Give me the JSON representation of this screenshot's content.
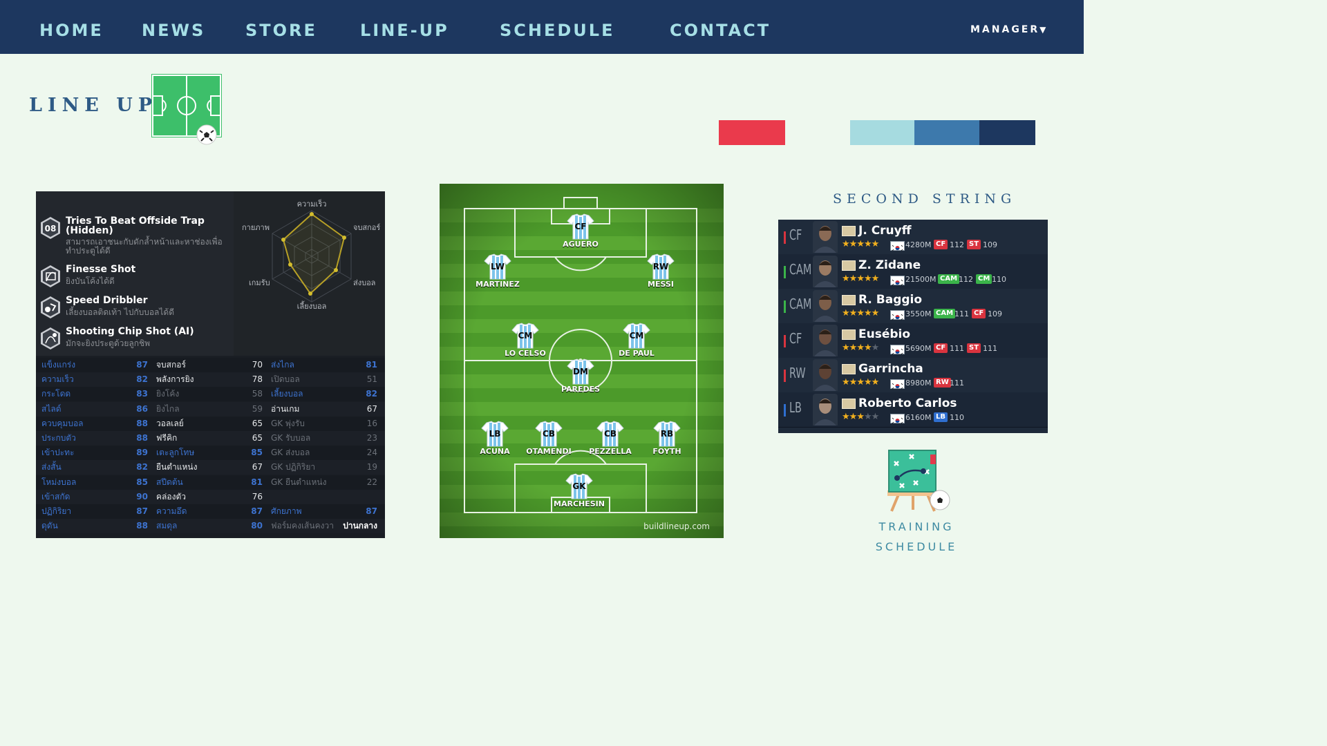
{
  "nav": {
    "items": [
      "HOME",
      "NEWS",
      "STORE",
      "LINE-UP",
      "SCHEDULE",
      "CONTACT"
    ],
    "manager_label": "MANAGER",
    "manager_caret": "▼"
  },
  "page": {
    "title": "LINE UP"
  },
  "palette": [
    "#ea3a4c",
    "#a6dbe0",
    "#3d79ac",
    "#1d375f"
  ],
  "skills": [
    {
      "badge": "08",
      "name": "Tries To Beat Offside Trap (Hidden)",
      "desc": "สามารถเอาชนะกับดักล้ำหน้าและหาช่องเพื่อทำประตูได้ดี"
    },
    {
      "badge": "finesse",
      "name": "Finesse Shot",
      "desc": "ยิงบันโค้งได้ดี"
    },
    {
      "badge": "dribble",
      "name": "Speed Dribbler",
      "desc": "เลี้ยงบอลติดเท้า ไปกับบอลได้ดี"
    },
    {
      "badge": "chip",
      "name": "Shooting Chip Shot (AI)",
      "desc": "มักจะยิงประตูด้วยลูกชิพ"
    }
  ],
  "radar": {
    "labels": [
      "ความเร็ว",
      "จบสกอร์",
      "ส่งบอล",
      "เลี้ยงบอล",
      "เกมรับ",
      "กายภาพ"
    ]
  },
  "stats": [
    [
      [
        "แข็งแกร่ง",
        "87"
      ],
      [
        "จบสกอร์",
        "70"
      ],
      [
        "ส่งไกล",
        "81"
      ]
    ],
    [
      [
        "ความเร็ว",
        "82"
      ],
      [
        "พลังการยิง",
        "78"
      ],
      [
        "เปิดบอล",
        "51"
      ]
    ],
    [
      [
        "กระโดด",
        "83"
      ],
      [
        "ยิงโค้ง",
        "58"
      ],
      [
        "เลี้ยงบอล",
        "82"
      ]
    ],
    [
      [
        "สไลด์",
        "86"
      ],
      [
        "ยิงไกล",
        "59"
      ],
      [
        "อ่านเกม",
        "67"
      ]
    ],
    [
      [
        "ควบคุมบอล",
        "88"
      ],
      [
        "วอลเลย์",
        "65"
      ],
      [
        "GK พุ่งรับ",
        "16"
      ]
    ],
    [
      [
        "ประกบตัว",
        "88"
      ],
      [
        "ฟรีคิก",
        "65"
      ],
      [
        "GK รับบอล",
        "23"
      ]
    ],
    [
      [
        "เข้าปะทะ",
        "89"
      ],
      [
        "เตะลูกโทษ",
        "85"
      ],
      [
        "GK ส่งบอล",
        "24"
      ]
    ],
    [
      [
        "ส่งสั้น",
        "82"
      ],
      [
        "ยืนตำแหน่ง",
        "67"
      ],
      [
        "GK ปฏิกิริยา",
        "19"
      ]
    ],
    [
      [
        "โหม่งบอล",
        "85"
      ],
      [
        "สปีดต้น",
        "81"
      ],
      [
        "GK ยืนตำแหน่ง",
        "22"
      ]
    ],
    [
      [
        "เข้าสกัด",
        "90"
      ],
      [
        "คล่องตัว",
        "76"
      ],
      [
        "",
        ""
      ]
    ],
    [
      [
        "ปฏิกิริยา",
        "87"
      ],
      [
        "ความอึด",
        "87"
      ],
      [
        "ศักยภาพ",
        "87"
      ]
    ],
    [
      [
        "ดุดัน",
        "88"
      ],
      [
        "สมดุล",
        "80"
      ],
      [
        "ฟอร์มคงเส้นคงวา",
        "ปานกลาง"
      ]
    ]
  ],
  "lineup": {
    "players": [
      {
        "pos": "CF",
        "name": "AGUERO"
      },
      {
        "pos": "LW",
        "name": "MARTINEZ"
      },
      {
        "pos": "RW",
        "name": "MESSI"
      },
      {
        "pos": "CM",
        "name": "LO CELSO"
      },
      {
        "pos": "CM",
        "name": "DE PAUL"
      },
      {
        "pos": "DM",
        "name": "PAREDES"
      },
      {
        "pos": "LB",
        "name": "ACUNA"
      },
      {
        "pos": "CB",
        "name": "OTAMENDI"
      },
      {
        "pos": "CB",
        "name": "PEZZELLA"
      },
      {
        "pos": "RB",
        "name": "FOYTH"
      },
      {
        "pos": "GK",
        "name": "MARCHESIN"
      }
    ],
    "watermark": "buildlineup.com"
  },
  "second_string": {
    "title": "SECOND STRING",
    "players": [
      {
        "pos": "CF",
        "pos_color": "#d9343f",
        "name": "J. Cruyff",
        "stars": 5,
        "price": "4280M",
        "tags": [
          {
            "t": "CF",
            "c": "#d9343f",
            "n": "112"
          },
          {
            "t": "ST",
            "c": "#d9343f",
            "n": "109"
          }
        ]
      },
      {
        "pos": "CAM",
        "pos_color": "#3bb44a",
        "name": "Z. Zidane",
        "stars": 5,
        "price": "21500M",
        "tags": [
          {
            "t": "CAM",
            "c": "#3bb44a",
            "n": "112"
          },
          {
            "t": "CM",
            "c": "#3bb44a",
            "n": "110"
          }
        ]
      },
      {
        "pos": "CAM",
        "pos_color": "#3bb44a",
        "name": "R. Baggio",
        "stars": 5,
        "price": "3550M",
        "tags": [
          {
            "t": "CAM",
            "c": "#3bb44a",
            "n": "111"
          },
          {
            "t": "CF",
            "c": "#d9343f",
            "n": "109"
          }
        ]
      },
      {
        "pos": "CF",
        "pos_color": "#d9343f",
        "name": "Eusébio",
        "stars": 4,
        "price": "5690M",
        "tags": [
          {
            "t": "CF",
            "c": "#d9343f",
            "n": "111"
          },
          {
            "t": "ST",
            "c": "#d9343f",
            "n": "111"
          }
        ]
      },
      {
        "pos": "RW",
        "pos_color": "#d9343f",
        "name": "Garrincha",
        "stars": 5,
        "price": "8980M",
        "tags": [
          {
            "t": "RW",
            "c": "#d9343f",
            "n": "111"
          }
        ]
      },
      {
        "pos": "LB",
        "pos_color": "#2f6fd0",
        "name": "Roberto Carlos",
        "stars": 3,
        "price": "6160M",
        "tags": [
          {
            "t": "LB",
            "c": "#2f6fd0",
            "n": "110"
          }
        ]
      }
    ]
  },
  "training": {
    "line1": "TRAINING",
    "line2": "SCHEDULE"
  }
}
